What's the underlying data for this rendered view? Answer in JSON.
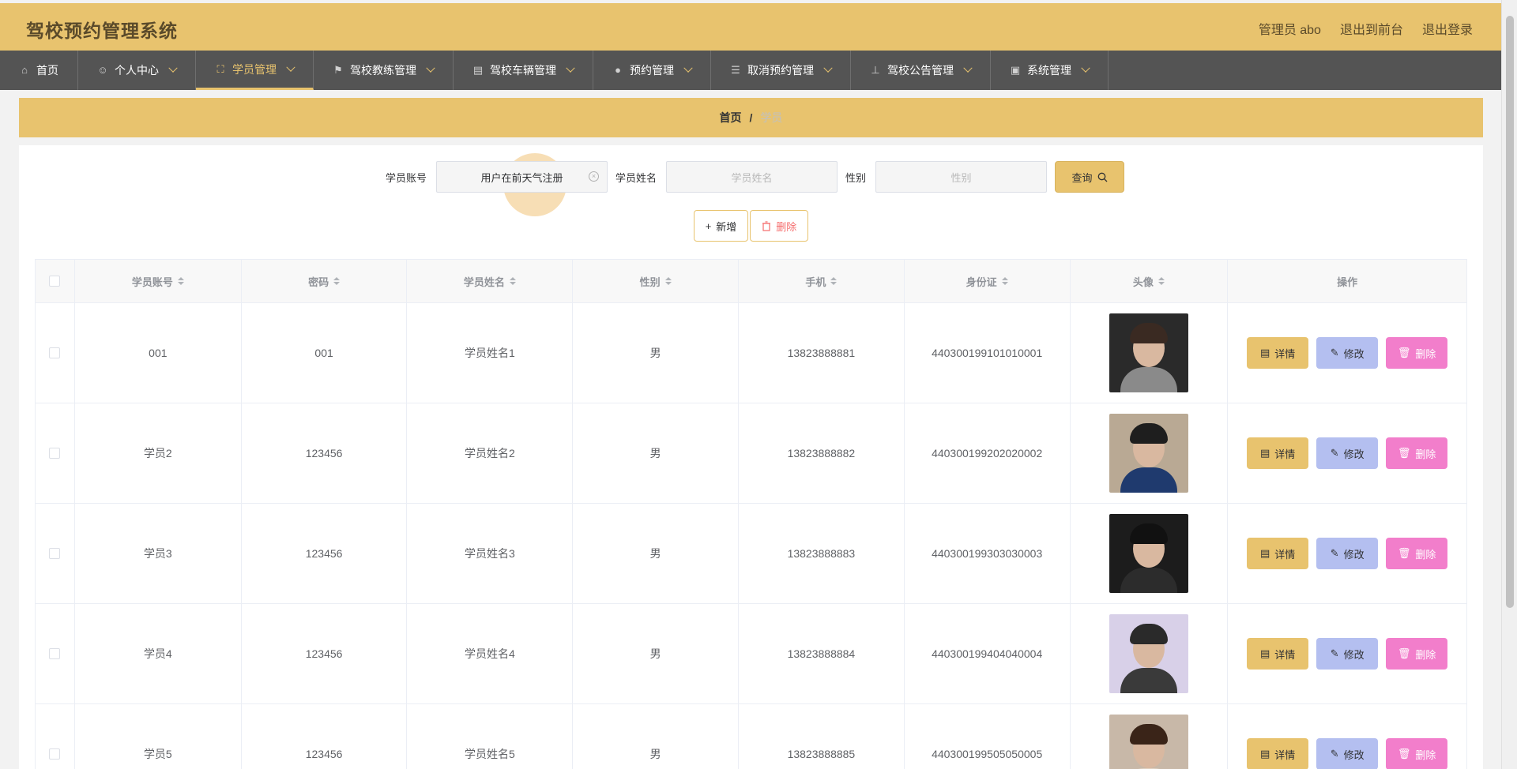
{
  "app": {
    "title": "驾校预约管理系统",
    "user_label": "管理员 abo",
    "to_front_label": "退出到前台",
    "logout_label": "退出登录"
  },
  "nav": [
    {
      "label": "首页",
      "icon": "home-icon",
      "glyph": "⌂",
      "active": false,
      "dropdown": false
    },
    {
      "label": "个人中心",
      "icon": "user-icon",
      "glyph": "☺",
      "active": false,
      "dropdown": true
    },
    {
      "label": "学员管理",
      "icon": "expand-icon",
      "glyph": "⛶",
      "active": true,
      "dropdown": true
    },
    {
      "label": "驾校教练管理",
      "icon": "flag-icon",
      "glyph": "⚑",
      "active": false,
      "dropdown": true
    },
    {
      "label": "驾校车辆管理",
      "icon": "clipboard-icon",
      "glyph": "▤",
      "active": false,
      "dropdown": true
    },
    {
      "label": "预约管理",
      "icon": "location-icon",
      "glyph": "●",
      "active": false,
      "dropdown": true
    },
    {
      "label": "取消预约管理",
      "icon": "sliders-icon",
      "glyph": "☰",
      "active": false,
      "dropdown": true
    },
    {
      "label": "驾校公告管理",
      "icon": "stamp-icon",
      "glyph": "⊥",
      "active": false,
      "dropdown": true
    },
    {
      "label": "系统管理",
      "icon": "chart-icon",
      "glyph": "▣",
      "active": false,
      "dropdown": true
    }
  ],
  "breadcrumb": {
    "home": "首页",
    "separator": "/",
    "current": "学员"
  },
  "search": {
    "account_label": "学员账号",
    "account_value": "用户在前天气注册",
    "name_label": "学员姓名",
    "name_placeholder": "学员姓名",
    "gender_label": "性别",
    "gender_placeholder": "性别",
    "query_label": "查询"
  },
  "toolbar": {
    "add_label": "新增",
    "delete_label": "删除"
  },
  "table": {
    "headers": [
      "学员账号",
      "密码",
      "学员姓名",
      "性别",
      "手机",
      "身份证",
      "头像",
      "操作"
    ],
    "detail_label": "详情",
    "edit_label": "修改",
    "delete_label": "删除",
    "rows": [
      {
        "account": "001",
        "password": "001",
        "name": "学员姓名1",
        "gender": "男",
        "phone": "13823888881",
        "idcard": "440300199101010001",
        "bg": "#2a2a2a",
        "hair": "#3a2a22",
        "shirt": "#8a8a8a"
      },
      {
        "account": "学员2",
        "password": "123456",
        "name": "学员姓名2",
        "gender": "男",
        "phone": "13823888882",
        "idcard": "440300199202020002",
        "bg": "#b9a994",
        "hair": "#1e1e1e",
        "shirt": "#1f3a6e"
      },
      {
        "account": "学员3",
        "password": "123456",
        "name": "学员姓名3",
        "gender": "男",
        "phone": "13823888883",
        "idcard": "440300199303030003",
        "bg": "#1c1c1c",
        "hair": "#111111",
        "shirt": "#2c2c2c"
      },
      {
        "account": "学员4",
        "password": "123456",
        "name": "学员姓名4",
        "gender": "男",
        "phone": "13823888884",
        "idcard": "440300199404040004",
        "bg": "#d8d0e8",
        "hair": "#2a2a2a",
        "shirt": "#3a3a3a"
      },
      {
        "account": "学员5",
        "password": "123456",
        "name": "学员姓名5",
        "gender": "男",
        "phone": "13823888885",
        "idcard": "440300199505050005",
        "bg": "#c8b8a8",
        "hair": "#3a2418",
        "shirt": "#e0d0c0"
      }
    ]
  }
}
